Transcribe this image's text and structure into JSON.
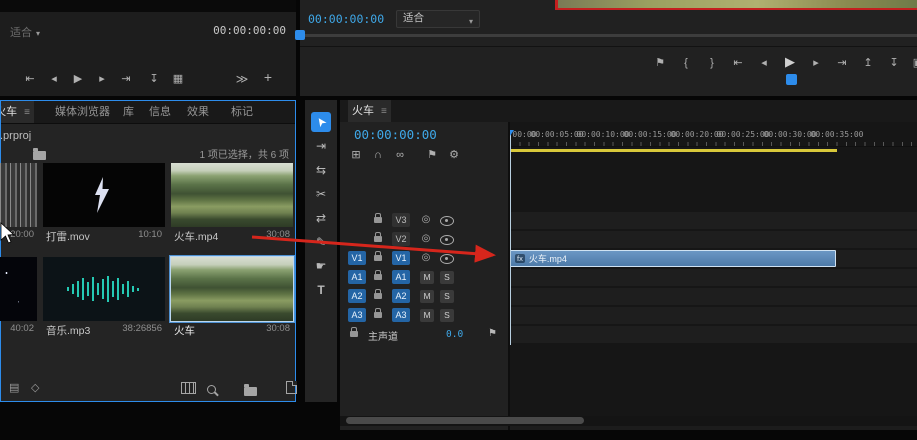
{
  "ui": {
    "menu_glyph": "≡",
    "caret": "▾"
  },
  "colors": {
    "accent_blue": "#2d8ceb",
    "timecode_blue": "#3fa8e8",
    "clip_blue": "#527fae",
    "work_area_yellow": "#d8c83a",
    "annotation_red": "#d6261c"
  },
  "source_monitor": {
    "fit_label": "适合",
    "timecode": "00:00:00:00",
    "transport_icons": [
      {
        "name": "go-to-in",
        "glyph": "⇤"
      },
      {
        "name": "step-back",
        "glyph": "◂"
      },
      {
        "name": "play",
        "glyph": "▶"
      },
      {
        "name": "step-forward",
        "glyph": "▸"
      },
      {
        "name": "go-to-out",
        "glyph": "⇥"
      },
      {
        "name": "insert",
        "glyph": "↧"
      },
      {
        "name": "overwrite",
        "glyph": "▦"
      }
    ],
    "overflow_label": "≫",
    "add_button_label": "+"
  },
  "program_monitor": {
    "timecode": "00:00:00:00",
    "fit_label": "适合",
    "transport_icons": [
      {
        "name": "add-marker",
        "glyph": "⚑"
      },
      {
        "name": "mark-in",
        "glyph": "{"
      },
      {
        "name": "mark-out",
        "glyph": "}"
      },
      {
        "name": "go-to-in",
        "glyph": "⇤"
      },
      {
        "name": "step-back",
        "glyph": "◂"
      },
      {
        "name": "play",
        "glyph": "▶"
      },
      {
        "name": "step-forward",
        "glyph": "▸"
      },
      {
        "name": "go-to-out",
        "glyph": "⇥"
      }
    ],
    "utility_icons": [
      {
        "name": "lift",
        "glyph": "↥"
      },
      {
        "name": "extract",
        "glyph": "↧"
      },
      {
        "name": "export-frame",
        "glyph": "▣"
      }
    ]
  },
  "project_panel": {
    "tabs": {
      "project": "项目: 火车",
      "media_browser": "媒体浏览器",
      "libraries": "库",
      "info": "信息",
      "effects": "效果",
      "markers": "标记"
    },
    "project_file": "火车.prproj",
    "selection_status": "1 项已选择，共 6 项",
    "items": [
      {
        "name": "",
        "duration": "20:00",
        "kind": "video-partial"
      },
      {
        "name": "打雷.mov",
        "duration": "10:10",
        "kind": "video"
      },
      {
        "name": "火车.mp4",
        "duration": "30:08",
        "kind": "video"
      },
      {
        "name": "",
        "duration": "40:02",
        "kind": "video-partial"
      },
      {
        "name": "音乐.mp3",
        "duration": "38:26856",
        "kind": "audio"
      },
      {
        "name": "火车",
        "duration": "30:08",
        "kind": "sequence",
        "selected": true
      }
    ]
  },
  "tools": [
    {
      "name": "selection-tool",
      "glyph": "➤",
      "active": true
    },
    {
      "name": "track-select-tool",
      "glyph": "⇥"
    },
    {
      "name": "ripple-edit-tool",
      "glyph": "⇆"
    },
    {
      "name": "razor-tool",
      "glyph": "✂"
    },
    {
      "name": "slip-tool",
      "glyph": "⇄"
    },
    {
      "name": "pen-tool",
      "glyph": "✎"
    },
    {
      "name": "hand-tool",
      "glyph": "☛"
    },
    {
      "name": "type-tool",
      "glyph": "T"
    }
  ],
  "timeline": {
    "tab_label": "火车",
    "timecode": "00:00:00:00",
    "toolbar_icons": [
      {
        "name": "nest-insert-toggle",
        "glyph": "⊞"
      },
      {
        "name": "snap-toggle",
        "glyph": "∩"
      },
      {
        "name": "linked-selection-toggle",
        "glyph": "∞"
      },
      {
        "name": "add-marker",
        "glyph": "⚑"
      },
      {
        "name": "timeline-settings",
        "glyph": "⚙"
      }
    ],
    "ruler_labels": [
      "00:00:00:00",
      "00:00:05:00",
      "00:00:10:00",
      "00:00:15:00",
      "00:00:20:00",
      "00:00:25:00",
      "00:00:30:00",
      "00:00:35:00"
    ],
    "audio_buttons": {
      "mute": "M",
      "solo": "S"
    },
    "track_icons": {
      "sync": "◎"
    },
    "tracks": [
      {
        "patch": "",
        "name": "V3",
        "kind": "video"
      },
      {
        "patch": "",
        "name": "V2",
        "kind": "video"
      },
      {
        "patch": "V1",
        "name": "V1",
        "kind": "video",
        "active": true
      },
      {
        "patch": "A1",
        "name": "A1",
        "kind": "audio",
        "active": true
      },
      {
        "patch": "A2",
        "name": "A2",
        "kind": "audio",
        "active": true
      },
      {
        "patch": "A3",
        "name": "A3",
        "kind": "audio",
        "active": true
      }
    ],
    "master_track": {
      "name": "主声道",
      "value": "0.0"
    },
    "clip": {
      "label": "火车.mp4",
      "badge": "fx"
    }
  }
}
